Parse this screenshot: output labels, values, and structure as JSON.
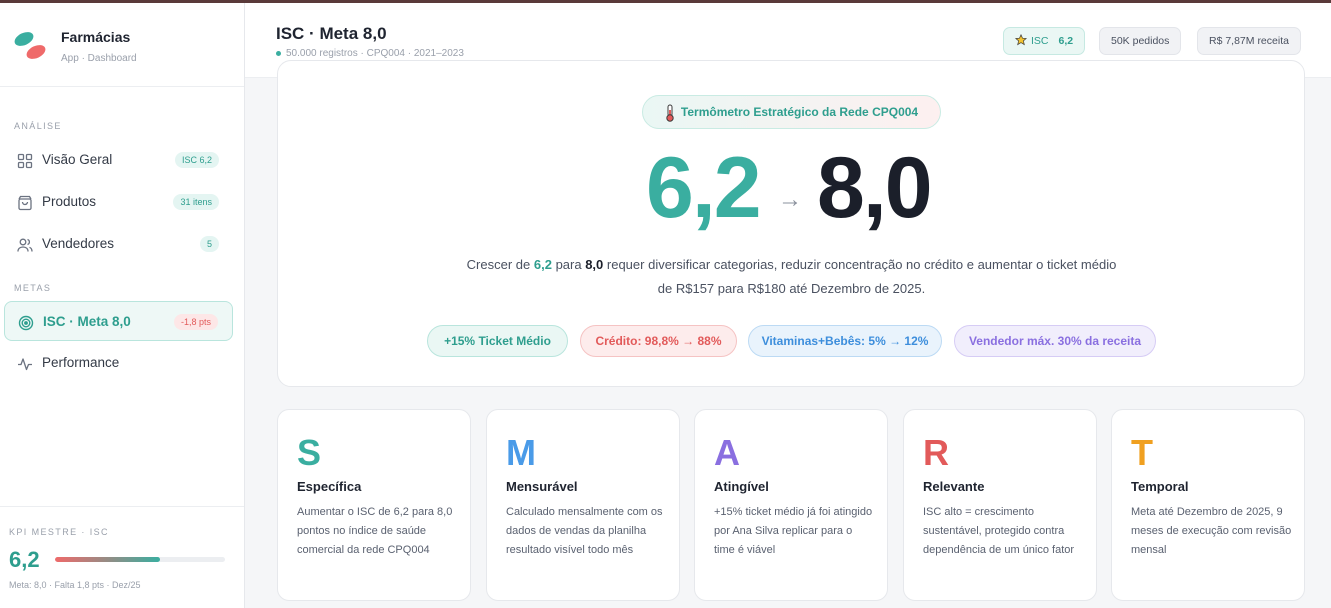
{
  "brand": {
    "name": "Farmácias",
    "subtitle": "App · Dashboard"
  },
  "sidebar": {
    "sections": [
      "ANÁLISE",
      "METAS"
    ],
    "items": [
      {
        "label": "Visão Geral",
        "badge": "ISC 6,2",
        "icon": "grid-icon"
      },
      {
        "label": "Produtos",
        "badge": "31 itens",
        "icon": "bag-icon"
      },
      {
        "label": "Vendedores",
        "badge": "5",
        "icon": "users-icon"
      },
      {
        "label": "ISC · Meta 8,0",
        "badge": "-1,8 pts",
        "icon": "target-icon",
        "active": true
      },
      {
        "label": "Performance",
        "badge": "",
        "icon": "activity-icon"
      }
    ]
  },
  "kpi": {
    "label": "KPI MESTRE · ISC",
    "value": "6,2",
    "progress": 0.62,
    "footer": "Meta: 8,0  ·  Falta 1,8 pts  ·  Dez/25"
  },
  "header": {
    "title": "ISC · Meta 8,0",
    "subtitle": "50.000 registros · CPQ004 · 2021–2023",
    "chips": {
      "isc_label": "ISC",
      "isc_value": "6,2",
      "orders": "50K pedidos",
      "revenue": "R$ 7,87M receita"
    }
  },
  "hero": {
    "pill": "Termômetro Estratégico da Rede CPQ004",
    "from": "6,2",
    "arrow": "→",
    "to": "8,0",
    "desc": {
      "p1": "Crescer de ",
      "v1": "6,2",
      "p2": " para ",
      "v2": "8,0",
      "p3": " requer diversificar categorias, reduzir concentração no crédito e aumentar o ticket médio de R$157 para R$180 até Dezembro de 2025."
    },
    "tags": [
      "+15% Ticket Médio",
      "Crédito: 98,8% → 88%",
      "Vitaminas+Bebês: 5% → 12%",
      "Vendedor máx. 30% da receita"
    ]
  },
  "smart": [
    {
      "letter": "S",
      "title": "Específica",
      "desc": "Aumentar o ISC de 6,2 para 8,0 pontos no índice de saúde comercial da rede CPQ004",
      "color": "#3aaea0"
    },
    {
      "letter": "M",
      "title": "Mensurável",
      "desc": "Calculado mensalmente com os dados de vendas da planilha resultado visível todo mês",
      "color": "#4a9be8"
    },
    {
      "letter": "A",
      "title": "Atingível",
      "desc": "+15% ticket médio já foi atingido por Ana Silva replicar para o time é viável",
      "color": "#8a6fe0"
    },
    {
      "letter": "R",
      "title": "Relevante",
      "desc": "ISC alto = crescimento sustentável, protegido contra dependência de um único fator",
      "color": "#e25a5a"
    },
    {
      "letter": "T",
      "title": "Temporal",
      "desc": "Meta até Dezembro de 2025, 9 meses de execução com revisão mensal",
      "color": "#f0a020"
    }
  ]
}
